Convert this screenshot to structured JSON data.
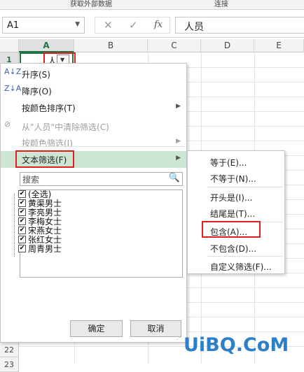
{
  "ribbon": {
    "group_left": "获取外部数据",
    "group_right": "连接"
  },
  "formula_bar": {
    "name_box": "A1",
    "name_box_arrow": "▼",
    "cancel_glyph": "✕",
    "enter_glyph": "✓",
    "fx_label": "fx",
    "value": "人员"
  },
  "columns": [
    "A",
    "B",
    "C",
    "D",
    "E"
  ],
  "rows": {
    "top": [
      "1"
    ],
    "bottom": [
      "22",
      "23"
    ]
  },
  "cell_a1": {
    "text": "人",
    "filter_arrow": "▼"
  },
  "filter_menu": {
    "sort_asc": {
      "label": "升序(S)",
      "icon": "sort-ascending-icon",
      "icon_glyph": "A↓Z"
    },
    "sort_desc": {
      "label": "降序(O)",
      "icon": "sort-descending-icon",
      "icon_glyph": "Z↓A"
    },
    "sort_by_color": {
      "label": "按颜色排序(T)"
    },
    "clear_filter": {
      "label": "从\"人员\"中清除筛选(C)",
      "icon": "clear-filter-icon",
      "icon_glyph": "⊘"
    },
    "filter_by_color": {
      "label": "按颜色筛选(I)"
    },
    "text_filter": {
      "label": "文本筛选(F)"
    },
    "search_placeholder": "搜索",
    "search_icon": "🔍",
    "items": [
      {
        "label": "(全选)",
        "checked": "✔"
      },
      {
        "label": "黄渠男士",
        "checked": "✔"
      },
      {
        "label": "李亮男士",
        "checked": "✔"
      },
      {
        "label": "李梅女士",
        "checked": "✔"
      },
      {
        "label": "宋燕女士",
        "checked": "✔"
      },
      {
        "label": "张红女士",
        "checked": "✔"
      },
      {
        "label": "周青男士",
        "checked": "✔"
      }
    ],
    "ok": "确定",
    "cancel": "取消"
  },
  "submenu": {
    "items": [
      {
        "label": "等于(E)..."
      },
      {
        "label": "不等于(N)..."
      },
      {
        "label": "开头是(I)..."
      },
      {
        "label": "结尾是(T)..."
      },
      {
        "label": "包含(A)..."
      },
      {
        "label": "不包含(D)..."
      },
      {
        "label": "自定义筛选(F)..."
      }
    ]
  },
  "watermark": "UiBQ.CoM",
  "colors": {
    "accent": "#217346",
    "highlight": "#cde6d3",
    "annotation": "#e02020",
    "watermark": "#2d7fc7"
  }
}
